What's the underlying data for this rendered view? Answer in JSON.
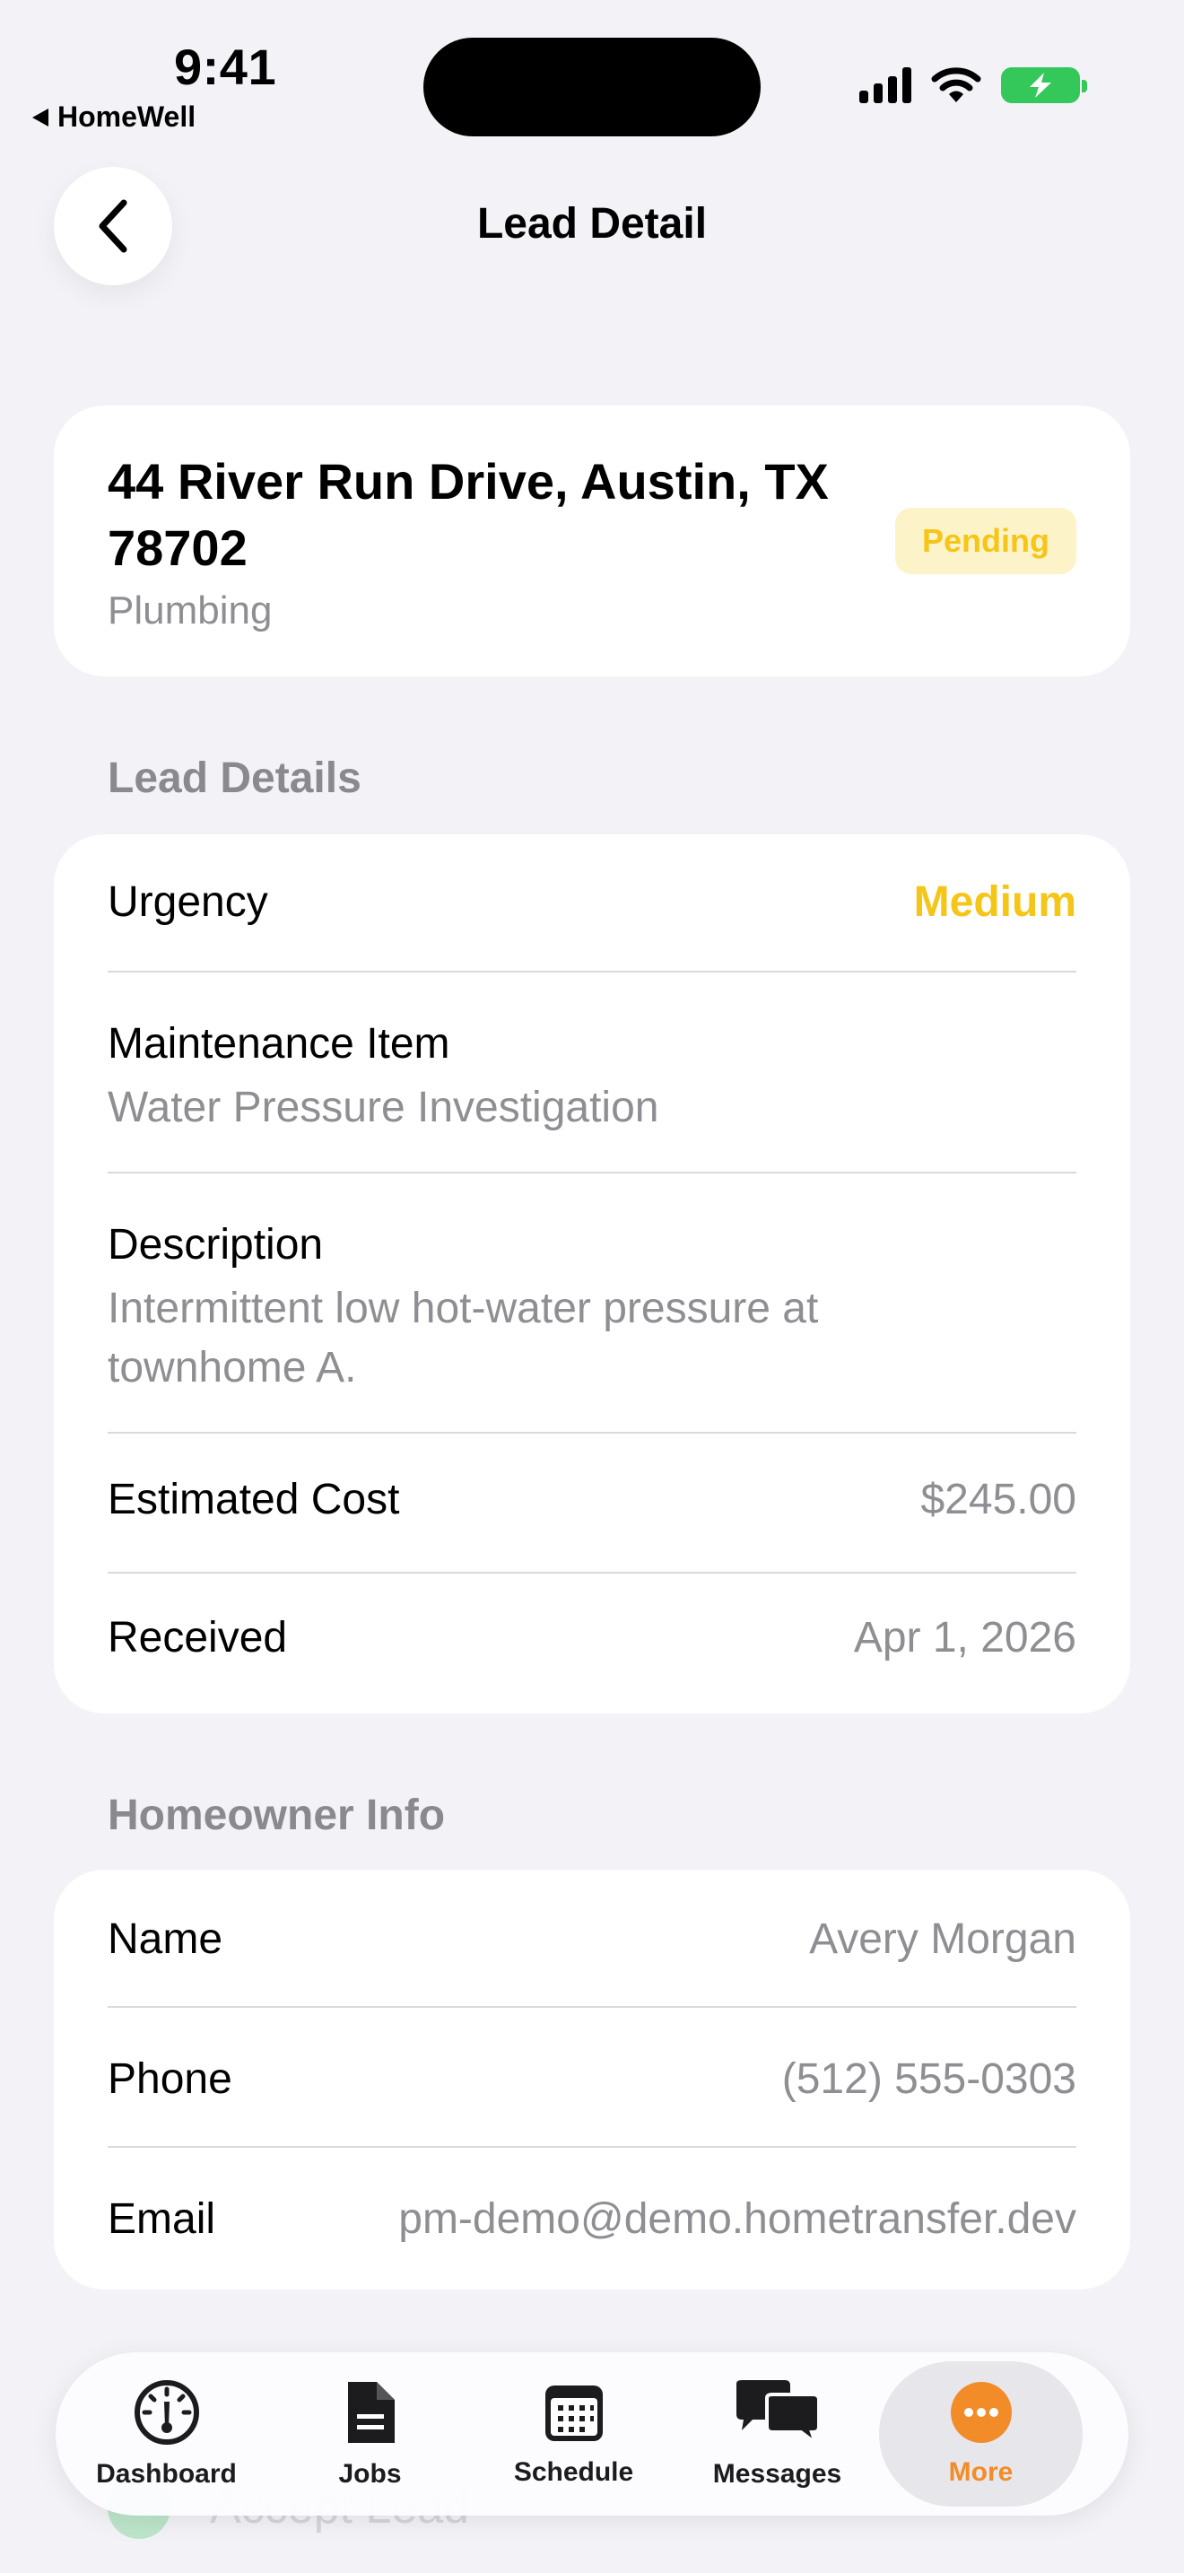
{
  "status_bar": {
    "time": "9:41",
    "back_app": "HomeWell"
  },
  "nav": {
    "title": "Lead Detail"
  },
  "lead": {
    "address": "44 River Run Drive, Austin, TX 78702",
    "category": "Plumbing",
    "status": "Pending"
  },
  "lead_details": {
    "section_title": "Lead Details",
    "urgency_label": "Urgency",
    "urgency_value": "Medium",
    "maintenance_label": "Maintenance Item",
    "maintenance_value": "Water Pressure Investigation",
    "description_label": "Description",
    "description_value": "Intermittent low hot-water pressure at townhome A.",
    "cost_label": "Estimated Cost",
    "cost_value": "$245.00",
    "received_label": "Received",
    "received_value": "Apr 1, 2026"
  },
  "homeowner": {
    "section_title": "Homeowner Info",
    "name_label": "Name",
    "name_value": "Avery Morgan",
    "phone_label": "Phone",
    "phone_value": "(512) 555-0303",
    "email_label": "Email",
    "email_value": "pm-demo@demo.hometransfer.dev"
  },
  "actions": {
    "accept_label": "Accept Lead"
  },
  "tabbar": {
    "tabs": [
      {
        "label": "Dashboard",
        "icon": "gauge-icon"
      },
      {
        "label": "Jobs",
        "icon": "document-icon"
      },
      {
        "label": "Schedule",
        "icon": "calendar-icon"
      },
      {
        "label": "Messages",
        "icon": "chat-bubbles-icon"
      },
      {
        "label": "More",
        "icon": "more-icon"
      }
    ],
    "active": "More"
  },
  "colors": {
    "background": "#f2f2f7",
    "accent": "#f28c28",
    "pending_text": "#f5c518",
    "pending_bg": "#fdf3c9",
    "urgency_medium": "#f5c518",
    "battery": "#34c759"
  }
}
